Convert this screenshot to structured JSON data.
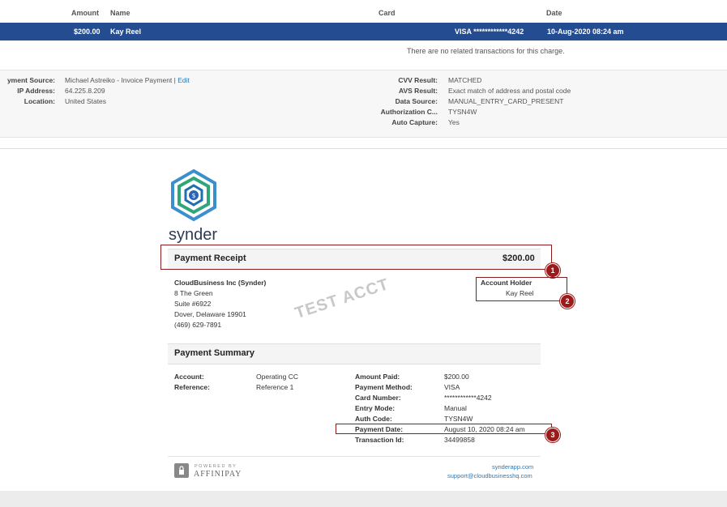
{
  "table": {
    "headers": {
      "amount": "Amount",
      "name": "Name",
      "card": "Card",
      "date": "Date"
    },
    "row": {
      "amount": "$200.00",
      "name": "Kay Reel",
      "card": "VISA ************4242",
      "date": "10-Aug-2020 08:24 am"
    },
    "no_related": "There are no related transactions for this charge."
  },
  "details": {
    "left": [
      {
        "label": "yment Source:",
        "value": "Michael Astreiko - Invoice Payment |",
        "link": "Edit"
      },
      {
        "label": "IP Address:",
        "value": "64.225.8.209"
      },
      {
        "label": "Location:",
        "value": "United States"
      }
    ],
    "right": [
      {
        "label": "CVV Result:",
        "value": "MATCHED"
      },
      {
        "label": "AVS Result:",
        "value": "Exact match of address and postal code"
      },
      {
        "label": "Data Source:",
        "value": "MANUAL_ENTRY_CARD_PRESENT"
      },
      {
        "label": "Authorization C...",
        "value": "TYSN4W"
      },
      {
        "label": "Auto Capture:",
        "value": "Yes"
      }
    ]
  },
  "receipt": {
    "logo_text": "synder",
    "title": "Payment Receipt",
    "total": "$200.00",
    "company": [
      "CloudBusiness Inc (Synder)",
      "8 The Green",
      "Suite #6922",
      "Dover, Delaware 19901",
      "(469) 629-7891"
    ],
    "holder_label": "Account Holder",
    "holder_name": "Kay Reel",
    "stamp": "TEST ACCT",
    "summary_title": "Payment Summary",
    "summary_left": [
      {
        "label": "Account:",
        "value": "Operating CC"
      },
      {
        "label": "Reference:",
        "value": "Reference 1"
      }
    ],
    "summary_right": [
      {
        "label": "Amount Paid:",
        "value": "$200.00"
      },
      {
        "label": "Payment Method:",
        "value": "VISA"
      },
      {
        "label": "Card Number:",
        "value": "************4242"
      },
      {
        "label": "Entry Mode:",
        "value": "Manual"
      },
      {
        "label": "Auth Code:",
        "value": "TYSN4W"
      },
      {
        "label": "Payment Date:",
        "value": "August 10, 2020 08:24 am"
      },
      {
        "label": "Transaction Id:",
        "value": "34499858"
      }
    ],
    "powered_by": "POWERED BY",
    "affinipay": "AFFINIPAY",
    "footer_link1": "synderapp.com",
    "footer_link2": "support@cloudbusinesshq.com"
  },
  "markers": [
    "1",
    "2",
    "3"
  ],
  "colors": {
    "selected_row": "#244c91",
    "annotation": "#9c1a1a",
    "link": "#2a78b8"
  }
}
